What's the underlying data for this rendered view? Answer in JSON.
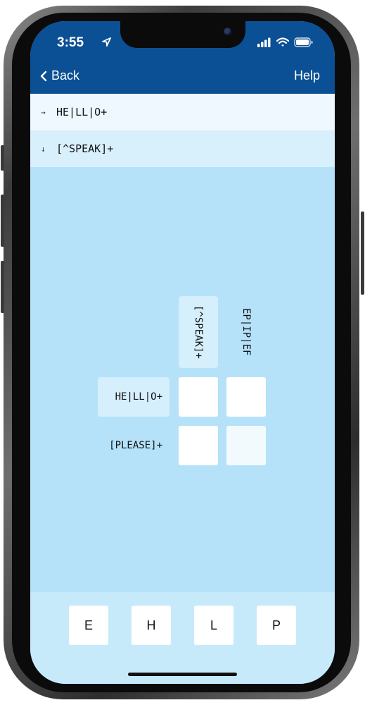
{
  "status_bar": {
    "time": "3:55",
    "icons": [
      "location-arrow-icon",
      "signal-icon",
      "wifi-icon",
      "battery-icon"
    ]
  },
  "nav": {
    "back_label": "Back",
    "help_label": "Help"
  },
  "clues": [
    {
      "direction_icon": "→",
      "text": "HE|LL|O+"
    },
    {
      "direction_icon": "↓",
      "text": "[^SPEAK]+"
    }
  ],
  "grid": {
    "column_clues": [
      "[^SPEAK]+",
      "EP|IP|EF"
    ],
    "row_clues": [
      "HE|LL|O+",
      "[PLEASE]+"
    ],
    "cells": [
      [
        "",
        ""
      ],
      [
        "",
        ""
      ]
    ]
  },
  "keyboard": {
    "keys": [
      "E",
      "H",
      "L",
      "P"
    ]
  },
  "colors": {
    "header": "#0b4f95",
    "background": "#b5e2f9",
    "active_clue": "#eef8fe",
    "highlight": "#d5effc"
  }
}
